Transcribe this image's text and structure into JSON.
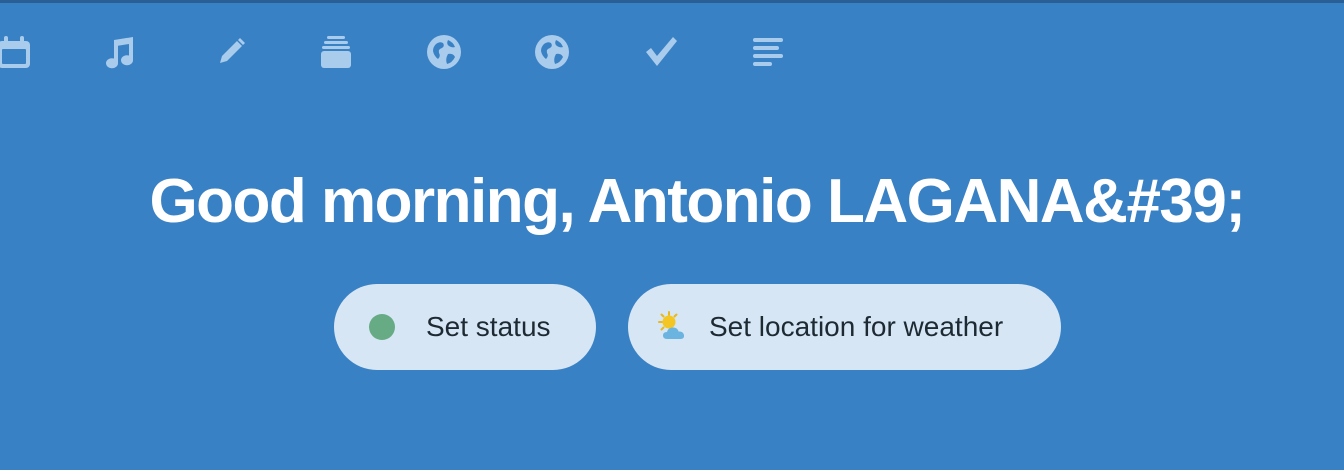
{
  "theme": {
    "background": "#3981c5",
    "icon_color": "#a9cbec",
    "pill_background": "#d6e6f4",
    "status_dot": "#66ab84"
  },
  "app_bar": {
    "icons": [
      {
        "name": "calendar-icon"
      },
      {
        "name": "music-note-icon"
      },
      {
        "name": "pencil-icon"
      },
      {
        "name": "stack-icon"
      },
      {
        "name": "globe-icon"
      },
      {
        "name": "globe-icon"
      },
      {
        "name": "checkmark-icon"
      },
      {
        "name": "text-lines-icon"
      }
    ]
  },
  "greeting": {
    "text": "Good morning, Antonio LAGANA&#39;"
  },
  "actions": {
    "status_label": "Set status",
    "weather_label": "Set location for weather"
  }
}
